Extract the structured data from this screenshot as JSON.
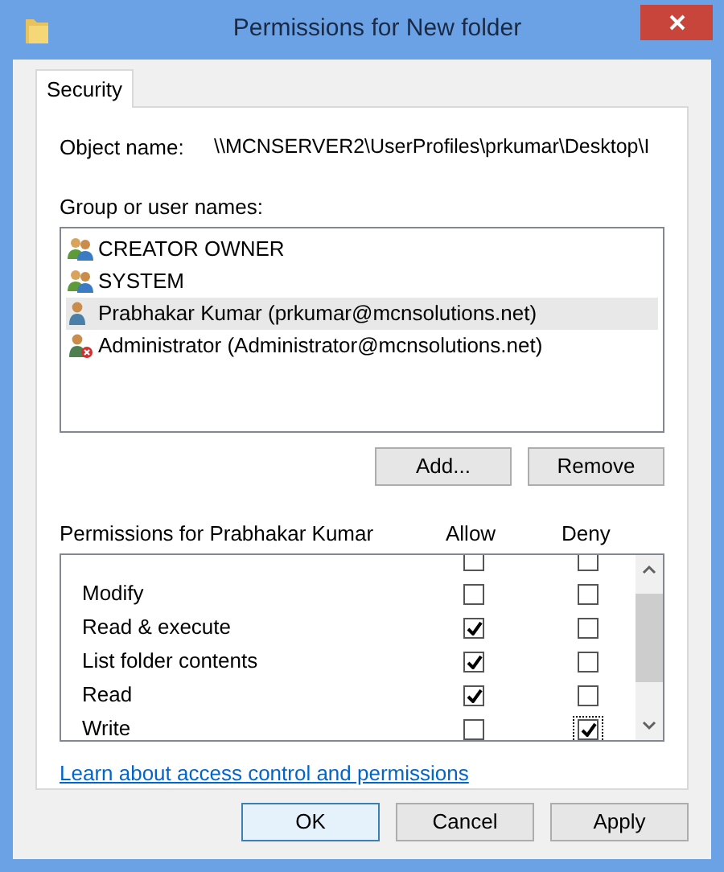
{
  "window": {
    "title": "Permissions for New folder"
  },
  "tabs": [
    {
      "label": "Security",
      "selected": true
    }
  ],
  "object_name": {
    "label": "Object name:",
    "value": "\\\\MCNSERVER2\\UserProfiles\\prkumar\\Desktop\\I"
  },
  "group_list": {
    "label": "Group or user names:",
    "items": [
      {
        "name": "CREATOR OWNER",
        "kind": "group",
        "selected": false
      },
      {
        "name": "SYSTEM",
        "kind": "group",
        "selected": false
      },
      {
        "name": "Prabhakar Kumar (prkumar@mcnsolutions.net)",
        "kind": "user",
        "selected": true
      },
      {
        "name": "Administrator (Administrator@mcnsolutions.net)",
        "kind": "denied",
        "selected": false
      }
    ]
  },
  "group_buttons": [
    "Add...",
    "Remove"
  ],
  "permissions": {
    "label": "Permissions for Prabhakar Kumar",
    "allow_heading": "Allow",
    "deny_heading": "Deny",
    "rows": [
      {
        "kind": "partial",
        "allow": false,
        "deny": false
      },
      {
        "kind": "full",
        "name": "Modify",
        "allow": false,
        "deny": false
      },
      {
        "kind": "full",
        "name": "Read & execute",
        "allow": true,
        "deny": false
      },
      {
        "kind": "full",
        "name": "List folder contents",
        "allow": true,
        "deny": false
      },
      {
        "kind": "full",
        "name": "Read",
        "allow": true,
        "deny": false
      },
      {
        "kind": "full",
        "name": "Write",
        "allow": false,
        "deny": true,
        "focused": true
      }
    ]
  },
  "link": "Learn about access control and permissions",
  "buttons": [
    {
      "label": "OK",
      "default": true
    },
    {
      "label": "Cancel",
      "default": false
    },
    {
      "label": "Apply",
      "default": false
    }
  ]
}
